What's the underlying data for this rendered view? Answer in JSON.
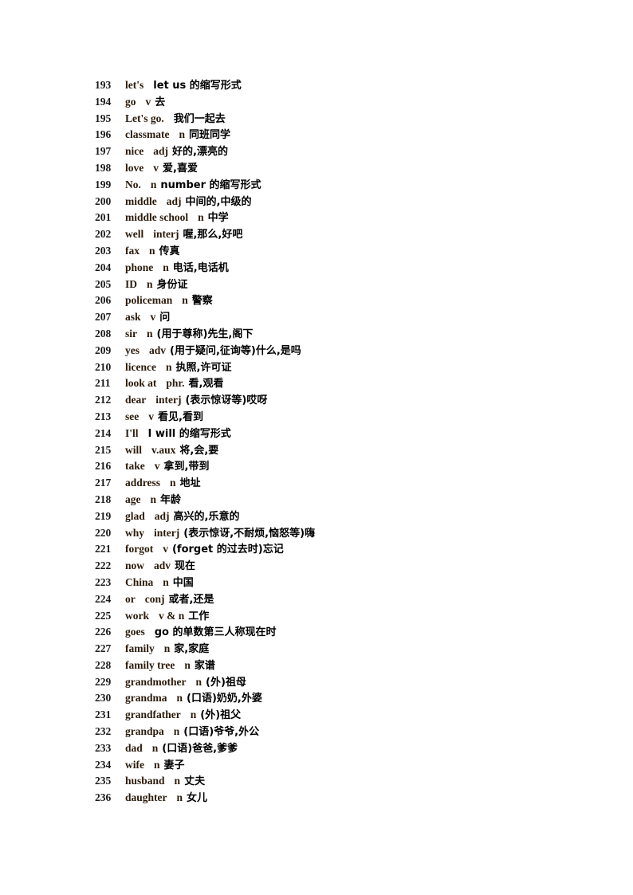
{
  "entries": [
    {
      "num": "193",
      "word": "let's",
      "pos": "",
      "def": "let us 的缩写形式"
    },
    {
      "num": "194",
      "word": "go",
      "pos": "v",
      "def": "去"
    },
    {
      "num": "195",
      "word": "Let's go.",
      "pos": "",
      "def": "我们一起去"
    },
    {
      "num": "196",
      "word": "classmate",
      "pos": "n",
      "def": "同班同学"
    },
    {
      "num": "197",
      "word": "nice",
      "pos": "adj",
      "def": "好的,漂亮的"
    },
    {
      "num": "198",
      "word": "love",
      "pos": "v",
      "def": "爱,喜爱"
    },
    {
      "num": "199",
      "word": "No.",
      "pos": "n",
      "def": "number 的缩写形式"
    },
    {
      "num": "200",
      "word": "middle",
      "pos": "adj",
      "def": "中间的,中级的"
    },
    {
      "num": "201",
      "word": "middle school",
      "pos": "n",
      "def": "中学"
    },
    {
      "num": "202",
      "word": "well",
      "pos": "interj",
      "def": "喔,那么,好吧"
    },
    {
      "num": "203",
      "word": "fax",
      "pos": "n",
      "def": "传真"
    },
    {
      "num": "204",
      "word": "phone",
      "pos": "n",
      "def": "电话,电话机"
    },
    {
      "num": "205",
      "word": "ID",
      "pos": "n",
      "def": "身份证"
    },
    {
      "num": "206",
      "word": "policeman",
      "pos": "n",
      "def": "警察"
    },
    {
      "num": "207",
      "word": "ask",
      "pos": "v",
      "def": "问"
    },
    {
      "num": "208",
      "word": "sir",
      "pos": "n",
      "def": "(用于尊称)先生,阁下"
    },
    {
      "num": "209",
      "word": "yes",
      "pos": "adv",
      "def": "(用于疑问,征询等)什么,是吗"
    },
    {
      "num": "210",
      "word": "licence",
      "pos": "n",
      "def": "执照,许可证"
    },
    {
      "num": "211",
      "word": "look at",
      "pos": "phr.",
      "def": "看,观看"
    },
    {
      "num": "212",
      "word": "dear",
      "pos": "interj",
      "def": "(表示惊讶等)哎呀"
    },
    {
      "num": "213",
      "word": "see",
      "pos": "v",
      "def": "看见,看到"
    },
    {
      "num": "214",
      "word": "I'll",
      "pos": "",
      "def": "I will 的缩写形式"
    },
    {
      "num": "215",
      "word": "will",
      "pos": "v.aux",
      "def": "将,会,要"
    },
    {
      "num": "216",
      "word": "take",
      "pos": "v",
      "def": "拿到,带到"
    },
    {
      "num": "217",
      "word": "address",
      "pos": "n",
      "def": "地址"
    },
    {
      "num": "218",
      "word": "age",
      "pos": "n",
      "def": "年龄"
    },
    {
      "num": "219",
      "word": "glad",
      "pos": "adj",
      "def": "高兴的,乐意的"
    },
    {
      "num": "220",
      "word": "why",
      "pos": "interj",
      "def": "(表示惊讶,不耐烦,恼怒等)嗨"
    },
    {
      "num": "221",
      "word": "forgot",
      "pos": "v",
      "def": "(forget 的过去时)忘记"
    },
    {
      "num": "222",
      "word": "now",
      "pos": "adv",
      "def": "现在"
    },
    {
      "num": "223",
      "word": "China",
      "pos": "n",
      "def": "中国"
    },
    {
      "num": "224",
      "word": "or",
      "pos": "conj",
      "def": "或者,还是"
    },
    {
      "num": "225",
      "word": "work",
      "pos": "v & n",
      "def": "工作"
    },
    {
      "num": "226",
      "word": "goes",
      "pos": "",
      "def": "go 的单数第三人称现在时"
    },
    {
      "num": "227",
      "word": "family",
      "pos": "n",
      "def": "家,家庭"
    },
    {
      "num": "228",
      "word": "family tree",
      "pos": "n",
      "def": "家谱"
    },
    {
      "num": "229",
      "word": "grandmother",
      "pos": "n",
      "def": "(外)祖母"
    },
    {
      "num": "230",
      "word": "grandma",
      "pos": "n",
      "def": "(口语)奶奶,外婆"
    },
    {
      "num": "231",
      "word": "grandfather",
      "pos": "n",
      "def": "(外)祖父"
    },
    {
      "num": "232",
      "word": "grandpa",
      "pos": "n",
      "def": "(口语)爷爷,外公"
    },
    {
      "num": "233",
      "word": "dad",
      "pos": "n",
      "def": "(口语)爸爸,爹爹"
    },
    {
      "num": "234",
      "word": "wife",
      "pos": "n",
      "def": "妻子"
    },
    {
      "num": "235",
      "word": "husband",
      "pos": "n",
      "def": "丈夫"
    },
    {
      "num": "236",
      "word": "daughter",
      "pos": "n",
      "def": "女儿"
    }
  ]
}
